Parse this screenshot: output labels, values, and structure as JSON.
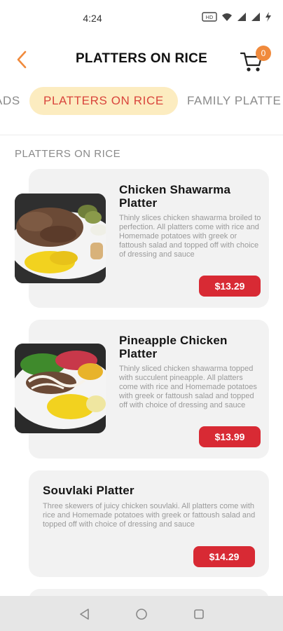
{
  "status_bar": {
    "time": "4:24",
    "icons": [
      "hd-volte-icon",
      "wifi-icon",
      "signal-icon",
      "signal-icon",
      "charging-icon"
    ]
  },
  "header": {
    "title": "PLATTERS ON RICE",
    "cart_count": "0"
  },
  "tabs": [
    {
      "label": "ADS",
      "active": false
    },
    {
      "label": "PLATTERS ON RICE",
      "active": true
    },
    {
      "label": "FAMILY PLATTE",
      "active": false
    }
  ],
  "section": {
    "heading": "PLATTERS ON RICE"
  },
  "items": [
    {
      "name": "Chicken Shawarma Platter",
      "description": "Thinly slices chicken shawarma broiled to perfection. All platters come with rice and Homemade potatoes with greek or fattoush salad and topped off with choice of dressing and sauce",
      "price": "$13.29"
    },
    {
      "name": "Pineapple Chicken Platter",
      "description": "Thinly sliced chicken shawarma topped with succulent pineapple. All platters come with rice and Homemade potatoes with greek or fattoush salad and topped off with choice of dressing and sauce",
      "price": "$13.99"
    },
    {
      "name": "Souvlaki Platter",
      "description": "Three skewers of juicy chicken souvlaki. All platters come with rice and Homemade potatoes with greek or fattoush salad and topped off with choice of dressing and sauce",
      "price": "$14.29"
    }
  ],
  "colors": {
    "accent": "#f08a3c",
    "price": "#d82a34",
    "tab_active_bg": "#fcecc0",
    "tab_active_text": "#d9453c"
  }
}
